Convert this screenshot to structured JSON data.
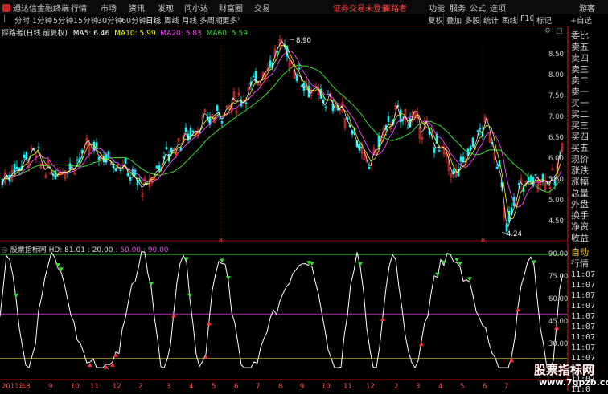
{
  "app": {
    "logo_text": "通达信金融终端",
    "menu": [
      "行情",
      "市场",
      "资讯",
      "发现",
      "问小达",
      "财富圈",
      "交易"
    ],
    "login_notice": "证券交易未登录",
    "stock_link": "探路者",
    "right_menu": [
      "功能",
      "服务",
      "公式",
      "选项",
      "游客"
    ]
  },
  "toolbar": {
    "periods": [
      "分时",
      "1分钟",
      "5分钟",
      "15分钟",
      "30分钟",
      "60分钟",
      "日线",
      "周线",
      "月线",
      "多周期",
      "更多"
    ],
    "selected": "日线",
    "buttons": [
      "复权",
      "叠加",
      "多股",
      "统计",
      "画线",
      "F10",
      "标记",
      "+自选",
      "返回"
    ]
  },
  "main_chart": {
    "title": "探路者(日线 前复权)",
    "ma": [
      {
        "label": "MA5: 6.46",
        "color": "#ffffff"
      },
      {
        "label": "MA10: 5.99",
        "color": "#ffff00"
      },
      {
        "label": "MA20: 5.83",
        "color": "#ff44ff"
      },
      {
        "label": "MA60: 5.59",
        "color": "#33dd33"
      }
    ],
    "y_ticks": [
      "8.50",
      "8.00",
      "7.50",
      "7.00",
      "6.50",
      "6.00",
      "5.50",
      "5.00",
      "4.50"
    ],
    "high_label": "8.90",
    "low_label": "4.24"
  },
  "indicator": {
    "title": "股票指标网 HD: 81.01 : 20.00",
    "title_extra": ": 50.00 : 90.00",
    "y_ticks": [
      "90.00",
      "75.00",
      "60.00",
      "45.00",
      "30.00"
    ]
  },
  "x_axis": [
    "2011年8",
    "9",
    "10",
    "11",
    "12",
    "2",
    "3",
    "4",
    "5",
    "6",
    "7",
    "8",
    "9",
    "10",
    "11",
    "12",
    "2",
    "3",
    "4",
    "5",
    "6",
    "7"
  ],
  "side_panel": {
    "rows": [
      "委比",
      "卖五",
      "卖四",
      "卖三",
      "卖二",
      "卖一",
      "买一",
      "买二",
      "买三",
      "买四",
      "买五",
      "现价",
      "涨跌",
      "涨幅",
      "总量",
      "外盘",
      "换手",
      "净资",
      "收益"
    ],
    "bottom_label": "自动",
    "bottom_label2": "行情",
    "times": [
      "11:07",
      "11:07",
      "11:07",
      "11:07",
      "11:07",
      "11:07",
      "11:07",
      "11:07",
      "11:07",
      "11:07",
      "11:07",
      "11:0"
    ]
  },
  "watermark": {
    "line1": "股票指标网",
    "line2": "www.7gpzb.com"
  },
  "colors": {
    "up": "#ff3333",
    "down": "#00ffff",
    "ma5": "#ffffff",
    "ma10": "#ffff00",
    "ma20": "#ff44ff",
    "ma60": "#33dd33",
    "indicator": "#ffffff",
    "line90": "#33dd33",
    "line50": "#aa33aa",
    "line20": "#ffff33"
  }
}
